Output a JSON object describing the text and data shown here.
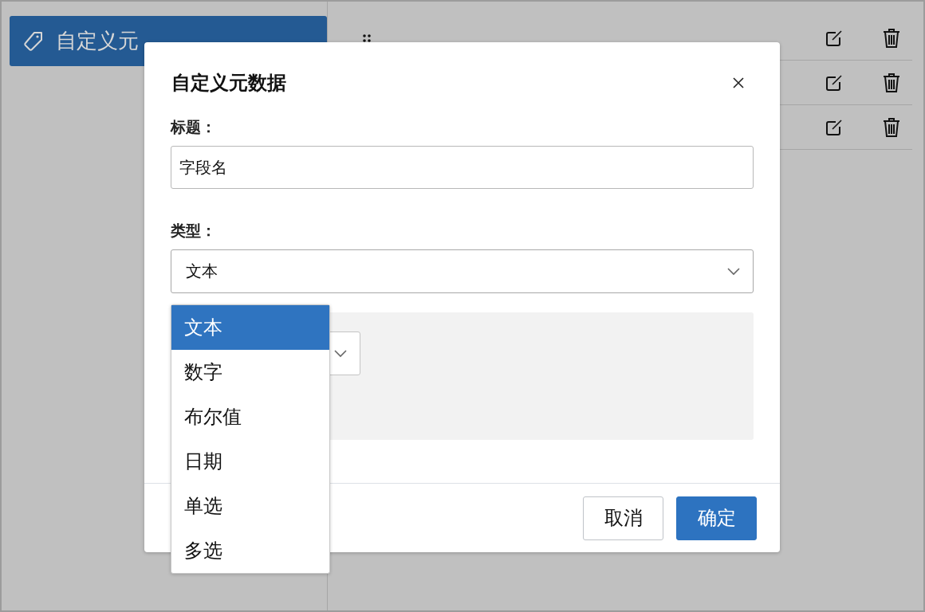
{
  "sidebar": {
    "items": [
      {
        "label": "自定义元",
        "selected": true
      }
    ]
  },
  "list": {
    "rows": [
      {
        "kind": "handle"
      },
      {
        "kind": "covered"
      },
      {
        "kind": "covered"
      }
    ]
  },
  "modal": {
    "title": "自定义元数据",
    "fields": [
      {
        "kind": "text",
        "label": "标题：",
        "value": "字段名"
      },
      {
        "kind": "select",
        "label": "类型：",
        "value": "文本",
        "expanded": true,
        "options": [
          {
            "label": "文本",
            "selected": true
          },
          {
            "label": "数字",
            "selected": false
          },
          {
            "label": "布尔值",
            "selected": false
          },
          {
            "label": "日期",
            "selected": false
          },
          {
            "label": "单选",
            "selected": false
          },
          {
            "label": "多选",
            "selected": false
          }
        ]
      }
    ],
    "buttons": [
      {
        "kind": "secondary",
        "label": "取消"
      },
      {
        "kind": "primary",
        "label": "确定"
      }
    ]
  }
}
